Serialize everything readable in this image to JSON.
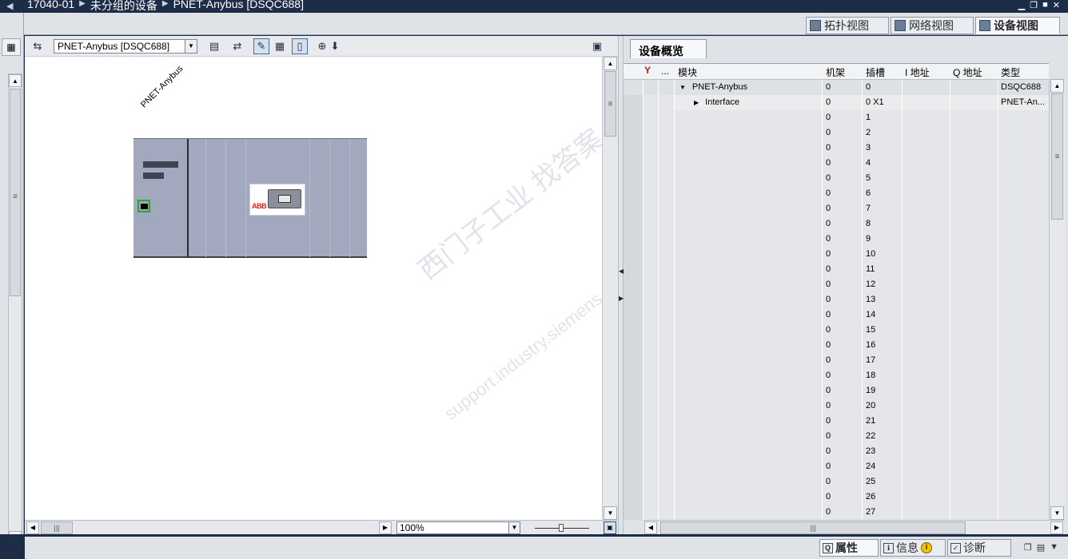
{
  "title_bar": {
    "breadcrumbs": [
      "17040-01",
      "未分组的设备",
      "PNET-Anybus [DSQC688]"
    ]
  },
  "view_tabs": [
    {
      "label": "拓扑视图",
      "icon": "topology-icon"
    },
    {
      "label": "网络视图",
      "icon": "network-icon"
    },
    {
      "label": "设备视图",
      "icon": "device-icon",
      "active": true
    }
  ],
  "graphic_toolbar": {
    "device_selector": "PNET-Anybus [DSQC688]"
  },
  "canvas": {
    "rack_label": "PNET-Anybus",
    "module_brand": "ABB",
    "zoom": "100%",
    "watermark_line1": "西门子工业  找答案",
    "watermark_line2": "support.industry.siemens.com/cs"
  },
  "overview": {
    "tab_label": "设备概览",
    "columns": {
      "dots": "...",
      "module": "模块",
      "rack": "机架",
      "slot": "插槽",
      "i_addr": "I 地址",
      "q_addr": "Q 地址",
      "type": "类型"
    },
    "rows": [
      {
        "module": "PNET-Anybus",
        "rack": "0",
        "slot": "0",
        "type": "DSQC688",
        "level": 0,
        "expanded": true
      },
      {
        "module": "Interface",
        "rack": "0",
        "slot": "0 X1",
        "type": "PNET-An...",
        "level": 1,
        "expanded": false
      },
      {
        "module": "",
        "rack": "0",
        "slot": "1",
        "type": ""
      },
      {
        "module": "",
        "rack": "0",
        "slot": "2",
        "type": ""
      },
      {
        "module": "",
        "rack": "0",
        "slot": "3",
        "type": ""
      },
      {
        "module": "",
        "rack": "0",
        "slot": "4",
        "type": ""
      },
      {
        "module": "",
        "rack": "0",
        "slot": "5",
        "type": ""
      },
      {
        "module": "",
        "rack": "0",
        "slot": "6",
        "type": ""
      },
      {
        "module": "",
        "rack": "0",
        "slot": "7",
        "type": ""
      },
      {
        "module": "",
        "rack": "0",
        "slot": "8",
        "type": ""
      },
      {
        "module": "",
        "rack": "0",
        "slot": "9",
        "type": ""
      },
      {
        "module": "",
        "rack": "0",
        "slot": "10",
        "type": ""
      },
      {
        "module": "",
        "rack": "0",
        "slot": "11",
        "type": ""
      },
      {
        "module": "",
        "rack": "0",
        "slot": "12",
        "type": ""
      },
      {
        "module": "",
        "rack": "0",
        "slot": "13",
        "type": ""
      },
      {
        "module": "",
        "rack": "0",
        "slot": "14",
        "type": ""
      },
      {
        "module": "",
        "rack": "0",
        "slot": "15",
        "type": ""
      },
      {
        "module": "",
        "rack": "0",
        "slot": "16",
        "type": ""
      },
      {
        "module": "",
        "rack": "0",
        "slot": "17",
        "type": ""
      },
      {
        "module": "",
        "rack": "0",
        "slot": "18",
        "type": ""
      },
      {
        "module": "",
        "rack": "0",
        "slot": "19",
        "type": ""
      },
      {
        "module": "",
        "rack": "0",
        "slot": "20",
        "type": ""
      },
      {
        "module": "",
        "rack": "0",
        "slot": "21",
        "type": ""
      },
      {
        "module": "",
        "rack": "0",
        "slot": "22",
        "type": ""
      },
      {
        "module": "",
        "rack": "0",
        "slot": "23",
        "type": ""
      },
      {
        "module": "",
        "rack": "0",
        "slot": "24",
        "type": ""
      },
      {
        "module": "",
        "rack": "0",
        "slot": "25",
        "type": ""
      },
      {
        "module": "",
        "rack": "0",
        "slot": "26",
        "type": ""
      },
      {
        "module": "",
        "rack": "0",
        "slot": "27",
        "type": ""
      }
    ]
  },
  "bottom_tabs": [
    {
      "label": "属性",
      "icon": "properties-icon",
      "active": true
    },
    {
      "label": "信息",
      "icon": "info-icon"
    },
    {
      "label": "诊断",
      "icon": "diagnostics-icon"
    }
  ],
  "colors": {
    "title_bar_bg": "#1d2d47",
    "panel_bg": "#dfe3e8",
    "rack_bg": "#a2a8be",
    "port_highlight": "#2ba52b",
    "abb_red": "#e3231b"
  }
}
